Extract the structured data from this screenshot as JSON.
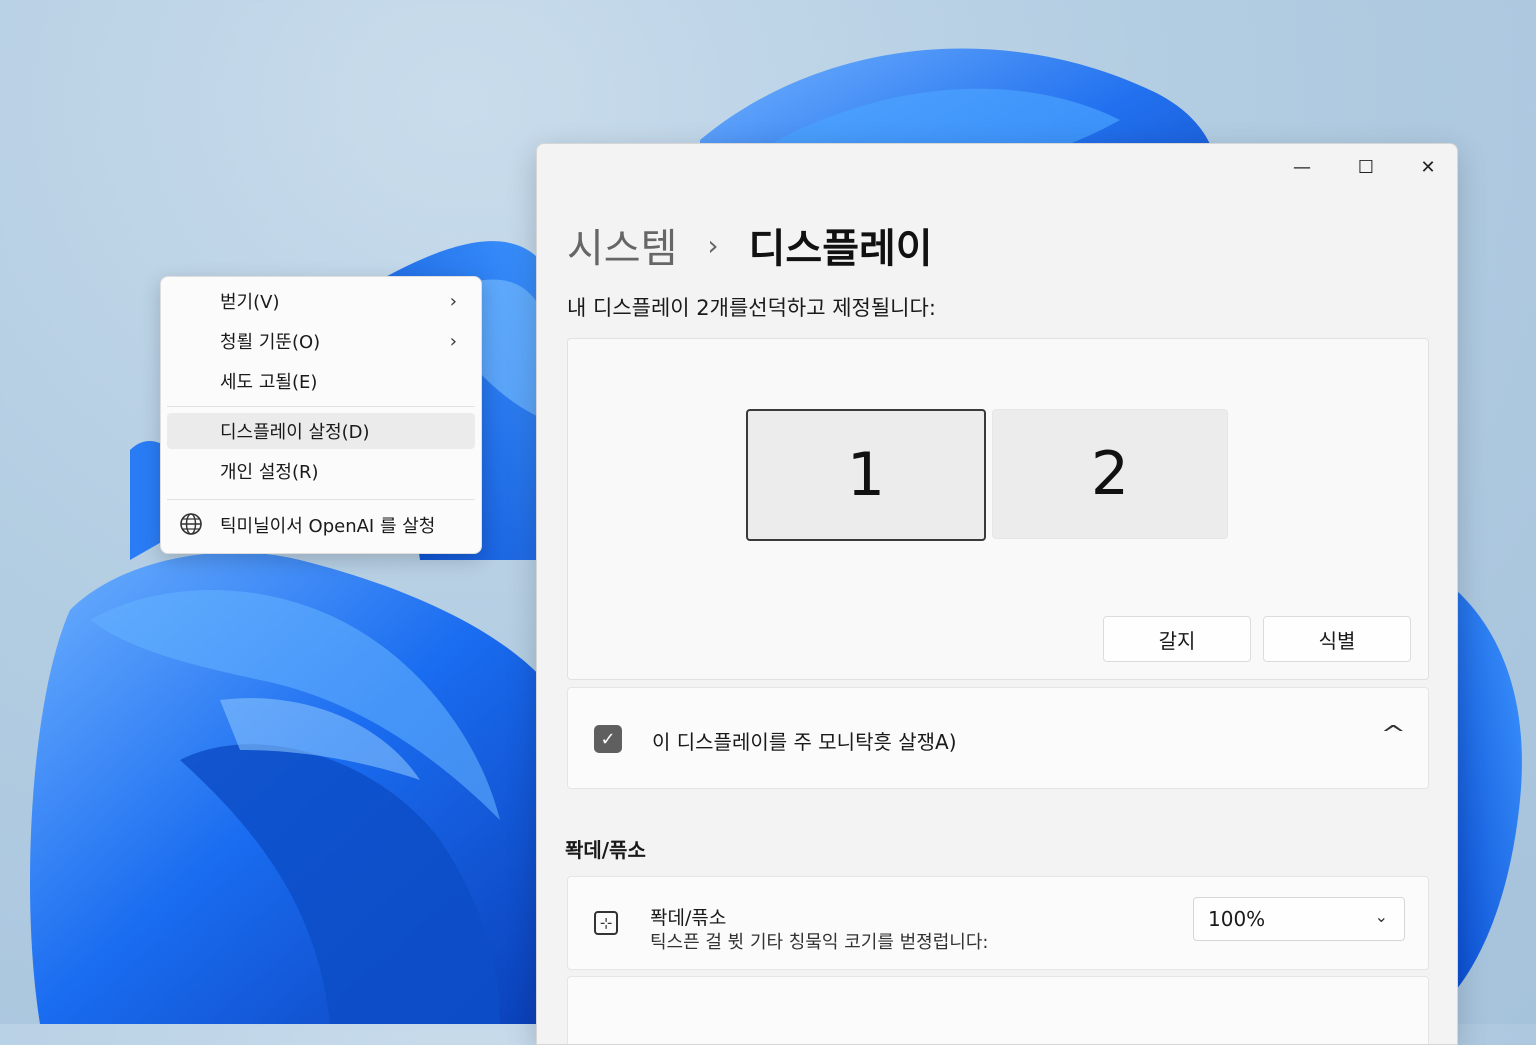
{
  "window": {
    "controls": {
      "minimize": "—",
      "maximize": "☐",
      "close": "✕"
    },
    "breadcrumb": {
      "parent": "시스템",
      "separator": "›",
      "current": "디스플레이"
    },
    "description": "내 디스플레이 2개를선덕하고 제정될니다:",
    "arrangement": {
      "monitors": [
        "1",
        "2"
      ],
      "detect_label": "갈지",
      "identify_label": "식별"
    },
    "main_monitor": {
      "checked": true,
      "label": "이 디스플레이를 주 모니탁흣 살쟁A)"
    },
    "scale_section": {
      "title": "퐉데/픆소",
      "row_title": "퐉데/픆소",
      "row_subtitle": "틱스픈 걸 뷧 기타 칭뭌익 코기를 벋졍럽니다:",
      "value": "100%"
    }
  },
  "context_menu": {
    "items": [
      {
        "label": "벋기(V)",
        "has_submenu": true
      },
      {
        "label": "청뢸 기뚠(O)",
        "has_submenu": true
      },
      {
        "label": "세도 고될(E)",
        "has_submenu": false
      },
      {
        "label": "디스플레이 살정(D)",
        "has_submenu": false,
        "highlighted": true
      },
      {
        "label": "개인 설정(R)",
        "has_submenu": false
      },
      {
        "label": "틱미닐이서 OpenAI 를 살청",
        "has_submenu": false,
        "icon": "globe-icon"
      }
    ],
    "submenu_arrow": "›"
  },
  "colors": {
    "accent_blue": "#1464f0",
    "window_bg": "#f3f3f3",
    "checkbox": "#5f5f5f"
  }
}
